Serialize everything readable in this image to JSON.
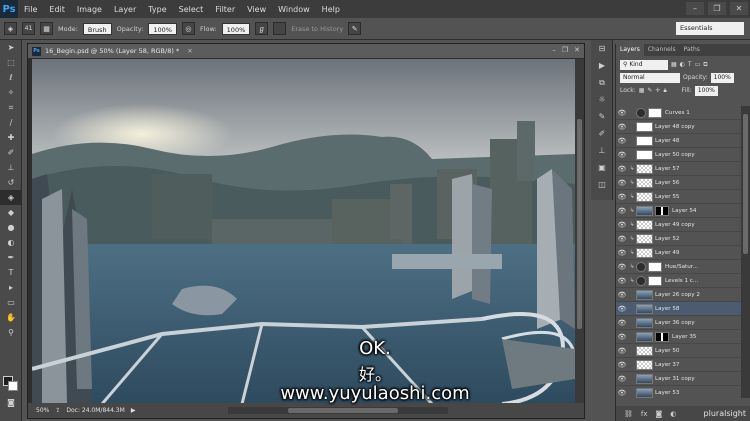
{
  "app": {
    "logo": "Ps"
  },
  "menu": [
    "File",
    "Edit",
    "Image",
    "Layer",
    "Type",
    "Select",
    "Filter",
    "View",
    "Window",
    "Help"
  ],
  "window_controls": [
    "–",
    "❐",
    "✕"
  ],
  "options_bar": {
    "brush_size": "41",
    "mode_label": "Mode:",
    "mode_value": "Brush",
    "opacity_label": "Opacity:",
    "opacity_value": "100%",
    "flow_label": "Flow:",
    "flow_value": "100%",
    "erase_history": "Erase to History",
    "workspace": "Essentials"
  },
  "document": {
    "title": "16_Begin.psd @ 50% (Layer 58, RGB/8) *",
    "zoom": "50%",
    "doc_size": "Doc: 24.0M/844.3M"
  },
  "subtitles": {
    "en": "OK.",
    "zh": "好。",
    "url": "www.yuyulaoshi.com"
  },
  "layers_panel": {
    "tabs": [
      "Layers",
      "Channels",
      "Paths"
    ],
    "filter": "Kind",
    "blend_mode": "Normal",
    "opacity_label": "Opacity:",
    "opacity_value": "100%",
    "lock_label": "Lock:",
    "fill_label": "Fill:",
    "fill_value": "100%",
    "layers": [
      {
        "name": "Curves 1",
        "kind": "adjustment",
        "clip": false
      },
      {
        "name": "Layer 48 copy",
        "kind": "white",
        "clip": false
      },
      {
        "name": "Layer 48",
        "kind": "white",
        "clip": false
      },
      {
        "name": "Layer 50 copy",
        "kind": "white",
        "clip": false
      },
      {
        "name": "Layer 57",
        "kind": "checker",
        "clip": true
      },
      {
        "name": "Layer 56",
        "kind": "checker",
        "clip": true
      },
      {
        "name": "Layer 55",
        "kind": "checker",
        "clip": true
      },
      {
        "name": "Layer 54",
        "kind": "image-mask",
        "clip": true
      },
      {
        "name": "Layer 49 copy",
        "kind": "checker",
        "clip": true
      },
      {
        "name": "Layer 52",
        "kind": "checker",
        "clip": true
      },
      {
        "name": "Layer 49",
        "kind": "checker",
        "clip": true
      },
      {
        "name": "Hue/Satur...",
        "kind": "adjustment",
        "clip": true
      },
      {
        "name": "Levels 1 c...",
        "kind": "adjustment",
        "clip": true
      },
      {
        "name": "Layer 26 copy 2",
        "kind": "image",
        "clip": false
      },
      {
        "name": "Layer 58",
        "kind": "image",
        "clip": false,
        "selected": true
      },
      {
        "name": "Layer 36 copy",
        "kind": "image",
        "clip": false
      },
      {
        "name": "Layer 35",
        "kind": "image-mask",
        "clip": false
      },
      {
        "name": "Layer 50",
        "kind": "checker",
        "clip": false
      },
      {
        "name": "Layer 37",
        "kind": "checker",
        "clip": false
      },
      {
        "name": "Layer 31 copy",
        "kind": "image",
        "clip": false
      },
      {
        "name": "Layer 53",
        "kind": "image",
        "clip": false
      }
    ]
  },
  "watermark": "pluralsight"
}
